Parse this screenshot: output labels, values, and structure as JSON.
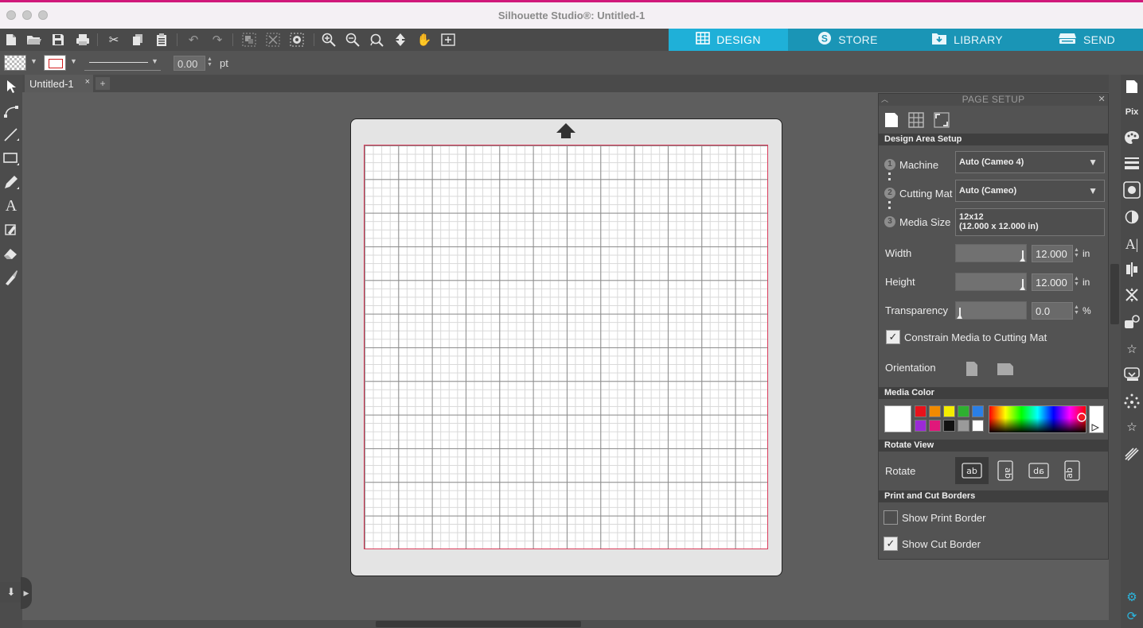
{
  "window": {
    "title": "Silhouette Studio®: Untitled-1"
  },
  "nav_tabs": [
    {
      "label": "DESIGN",
      "icon": "grid-icon",
      "active": true
    },
    {
      "label": "STORE",
      "icon": "store-s-icon",
      "active": false
    },
    {
      "label": "LIBRARY",
      "icon": "library-download-icon",
      "active": false
    },
    {
      "label": "SEND",
      "icon": "send-cutter-icon",
      "active": false
    }
  ],
  "property_bar": {
    "line_weight": "0.00",
    "line_unit": "pt"
  },
  "document_tabs": [
    {
      "label": "Untitled-1",
      "close": "×"
    }
  ],
  "add_tab_label": "+",
  "page_setup": {
    "title": "PAGE SETUP",
    "design_area_setup": "Design Area Setup",
    "machine": {
      "step": "1",
      "label": "Machine",
      "value": "Auto (Cameo 4)"
    },
    "cutting_mat": {
      "step": "2",
      "label": "Cutting Mat",
      "value": "Auto (Cameo)"
    },
    "media_size": {
      "step": "3",
      "label": "Media Size",
      "value_line1": "12x12",
      "value_line2": "(12.000 x 12.000 in)"
    },
    "width": {
      "label": "Width",
      "value": "12.000",
      "unit": "in",
      "slider_level": 1.0
    },
    "height": {
      "label": "Height",
      "value": "12.000",
      "unit": "in",
      "slider_level": 1.0
    },
    "transparency": {
      "label": "Transparency",
      "value": "0.0",
      "unit": "%",
      "slider_level": 0.0
    },
    "constrain": {
      "label": "Constrain Media to Cutting Mat",
      "checked": true
    },
    "orientation": {
      "label": "Orientation"
    },
    "media_color": {
      "heading": "Media Color",
      "swatches": [
        "#e8121b",
        "#f08a00",
        "#f4ec00",
        "#2eb030",
        "#2a7fe6",
        "#9b2ad6",
        "#e0187a",
        "#111111",
        "#9a9a9a",
        "#ffffff"
      ],
      "selected": "#ffffff"
    },
    "rotate_view": {
      "heading": "Rotate View",
      "label": "Rotate",
      "options": [
        "ab",
        "ab",
        "ab",
        "ab"
      ]
    },
    "print_cut_borders": {
      "heading": "Print and Cut Borders",
      "show_print_border": {
        "label": "Show Print Border",
        "checked": false
      },
      "show_cut_border": {
        "label": "Show Cut Border",
        "checked": true
      }
    }
  }
}
